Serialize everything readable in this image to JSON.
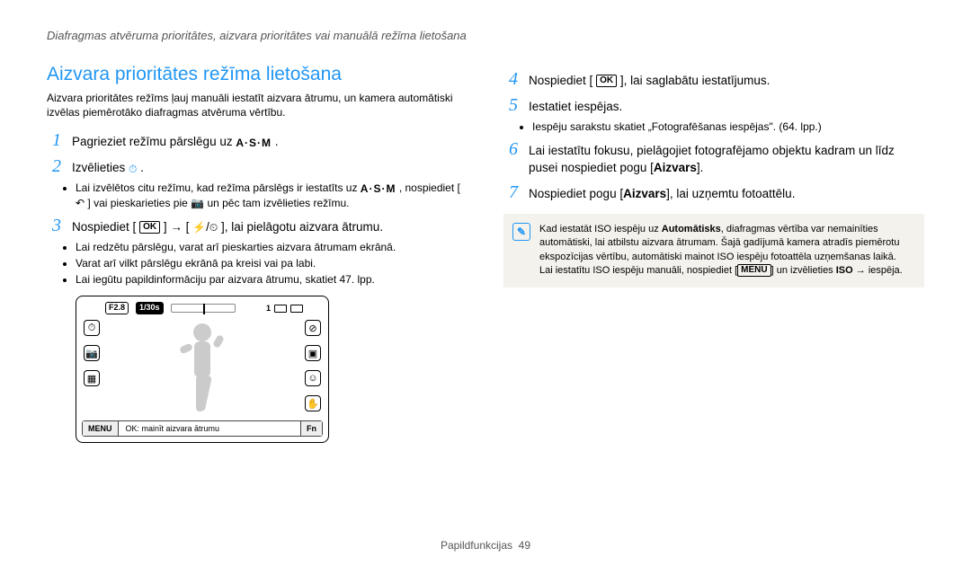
{
  "breadcrumb": "Diafragmas atvēruma prioritātes, aizvara prioritātes vai manuālā režīma lietošana",
  "section_title": "Aizvara prioritātes režīma lietošana",
  "intro": "Aizvara prioritātes režīms ļauj manuāli iestatīt aizvara ātrumu, un kamera automātiski izvēlas piemērotāko diafragmas atvēruma vērtību.",
  "left_steps": {
    "s1": {
      "num": "1",
      "pre": "Pagrieziet režīmu pārslēgu uz ",
      "mode": "A·S·M",
      "post": "."
    },
    "s2": {
      "num": "2",
      "pre": "Izvēlieties ",
      "post": ".",
      "sub1_pre": "Lai izvēlētos citu režīmu, kad režīma pārslēgs ir iestatīts uz ",
      "sub1_post": ", nospiediet [",
      "sub1_tail": "] vai pieskarieties pie ",
      "sub1_end": " un pēc tam izvēlieties režīmu."
    },
    "s3": {
      "num": "3",
      "pre": "Nospiediet [",
      "btn": "OK",
      "mid": "] → [",
      "post": "], lai pielāgotu aizvara ātrumu.",
      "sub1": "Lai redzētu pārslēgu, varat arī pieskarties aizvara ātrumam ekrānā.",
      "sub2": "Varat arī vilkt pārslēgu ekrānā pa kreisi vai pa labi.",
      "sub3": "Lai iegūtu papildinformāciju par aizvara ātrumu, skatiet 47. lpp."
    }
  },
  "right_steps": {
    "s4": {
      "num": "4",
      "pre": "Nospiediet [",
      "btn": "OK",
      "post": "], lai saglabātu iestatījumus."
    },
    "s5": {
      "num": "5",
      "text": "Iestatiet iespējas.",
      "sub1": "Iespēju sarakstu skatiet „Fotografēšanas iespējas\". (64. lpp.)"
    },
    "s6": {
      "num": "6",
      "text": "Lai iestatītu fokusu, pielāgojiet fotografējamo objektu kadram un līdz pusei nospiediet pogu [",
      "bold": "Aizvars",
      "post": "]."
    },
    "s7": {
      "num": "7",
      "text": "Nospiediet pogu [",
      "bold": "Aizvars",
      "post": "], lai uzņemtu fotoattēlu."
    }
  },
  "note": {
    "t1": "Kad iestatāt ISO iespēju uz ",
    "auto": "Automātisks",
    "t2": ", diafragmas vērtība var nemainīties automātiski, lai atbilstu aizvara ātrumam. Šajā gadījumā kamera atradīs piemērotu ekspozīcijas vērtību, automātiski mainot ISO iespēju fotoattēla uzņemšanas laikā. Lai iestatītu ISO iespēju manuāli, nospiediet [",
    "menu": "MENU",
    "t3": "] un izvēlieties ",
    "iso": "ISO",
    "t4": " → iespēja."
  },
  "camera": {
    "f": "F2.8",
    "t": "1/30s",
    "count": "1",
    "menu": "MENU",
    "msg": "OK: mainīt aizvara ātrumu",
    "fn": "Fn"
  },
  "footer": {
    "label": "Papildfunkcijas",
    "page": "49"
  }
}
